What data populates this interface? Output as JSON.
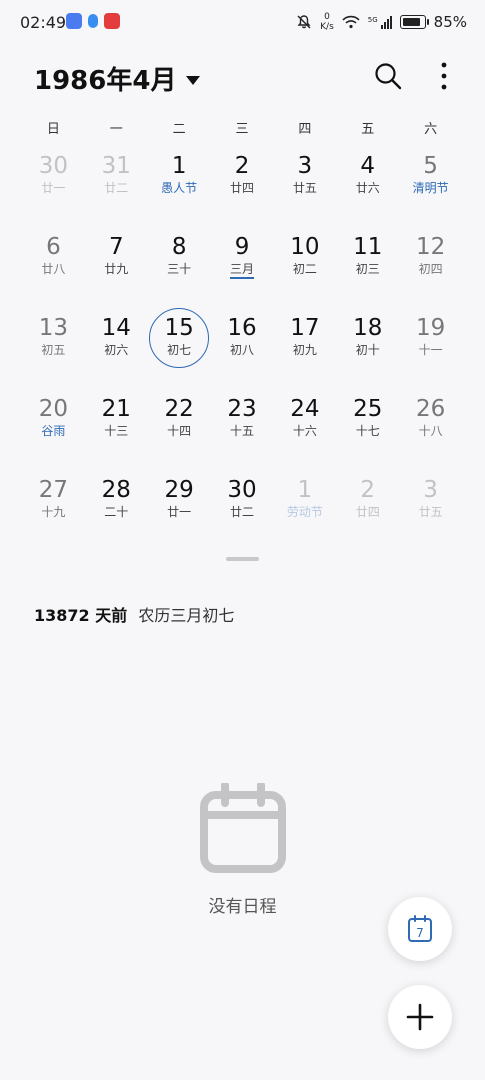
{
  "status_bar": {
    "time": "02:49",
    "net_speed_value": "0",
    "net_speed_unit": "K/s",
    "signal": "5G",
    "battery": "85%",
    "icons": [
      "mail-app-icon",
      "blue-app-icon",
      "red-app-icon",
      "mute-icon",
      "wifi-icon",
      "signal-icon",
      "battery-icon"
    ]
  },
  "header": {
    "month_title": "1986年4月",
    "icons": [
      "search-icon",
      "more-vertical-icon"
    ]
  },
  "weekdays": [
    "日",
    "一",
    "二",
    "三",
    "四",
    "五",
    "六"
  ],
  "weeks": [
    [
      {
        "day": "30",
        "lunar": "廿一",
        "type": "other"
      },
      {
        "day": "31",
        "lunar": "廿二",
        "type": "other"
      },
      {
        "day": "1",
        "lunar": "愚人节",
        "festival": true
      },
      {
        "day": "2",
        "lunar": "廿四"
      },
      {
        "day": "3",
        "lunar": "廿五"
      },
      {
        "day": "4",
        "lunar": "廿六"
      },
      {
        "day": "5",
        "lunar": "清明节",
        "festival": true,
        "weekend": true
      }
    ],
    [
      {
        "day": "6",
        "lunar": "廿八",
        "weekend": true
      },
      {
        "day": "7",
        "lunar": "廿九"
      },
      {
        "day": "8",
        "lunar": "三十"
      },
      {
        "day": "9",
        "lunar": "三月",
        "underline": true
      },
      {
        "day": "10",
        "lunar": "初二"
      },
      {
        "day": "11",
        "lunar": "初三"
      },
      {
        "day": "12",
        "lunar": "初四",
        "weekend": true
      }
    ],
    [
      {
        "day": "13",
        "lunar": "初五",
        "weekend": true
      },
      {
        "day": "14",
        "lunar": "初六"
      },
      {
        "day": "15",
        "lunar": "初七",
        "today": true
      },
      {
        "day": "16",
        "lunar": "初八"
      },
      {
        "day": "17",
        "lunar": "初九"
      },
      {
        "day": "18",
        "lunar": "初十"
      },
      {
        "day": "19",
        "lunar": "十一",
        "weekend": true
      }
    ],
    [
      {
        "day": "20",
        "lunar": "谷雨",
        "festival": true,
        "weekend": true
      },
      {
        "day": "21",
        "lunar": "十三"
      },
      {
        "day": "22",
        "lunar": "十四"
      },
      {
        "day": "23",
        "lunar": "十五"
      },
      {
        "day": "24",
        "lunar": "十六"
      },
      {
        "day": "25",
        "lunar": "十七"
      },
      {
        "day": "26",
        "lunar": "十八",
        "weekend": true
      }
    ],
    [
      {
        "day": "27",
        "lunar": "十九",
        "weekend": true
      },
      {
        "day": "28",
        "lunar": "二十"
      },
      {
        "day": "29",
        "lunar": "廿一"
      },
      {
        "day": "30",
        "lunar": "廿二"
      },
      {
        "day": "1",
        "lunar": "劳动节",
        "festival": true,
        "type": "other"
      },
      {
        "day": "2",
        "lunar": "廿四",
        "type": "other"
      },
      {
        "day": "3",
        "lunar": "廿五",
        "type": "other"
      }
    ]
  ],
  "info": {
    "days_ago": "13872 天前",
    "lunar_date": "农历三月初七"
  },
  "empty_state": {
    "icon": "calendar-empty-icon",
    "text": "没有日程"
  },
  "fab": {
    "today_number": "7",
    "today_icon": "today-calendar-icon",
    "add_icon": "plus-icon"
  },
  "colors": {
    "accent": "#2e6ab5",
    "background": "#f7f7f9"
  }
}
